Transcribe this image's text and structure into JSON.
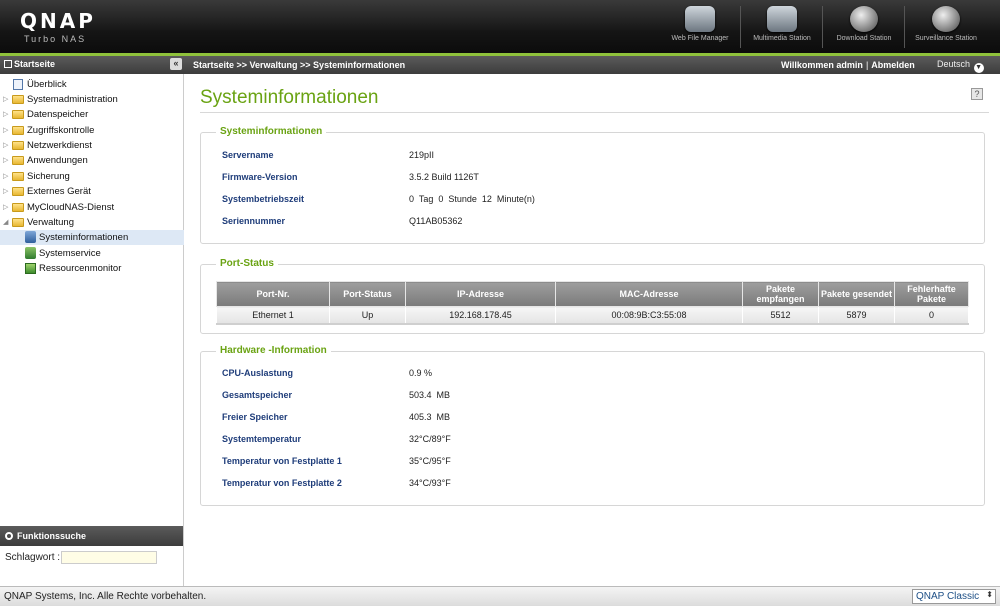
{
  "header": {
    "logo": "QNAP",
    "logo_sub": "Turbo NAS",
    "stations": [
      {
        "label": "Web File Manager",
        "icon": "web-file-manager-icon"
      },
      {
        "label": "Multimedia Station",
        "icon": "multimedia-station-icon"
      },
      {
        "label": "Download Station",
        "icon": "download-station-icon"
      },
      {
        "label": "Surveillance Station",
        "icon": "surveillance-station-icon"
      }
    ]
  },
  "navbar": {
    "home_label": "Startseite",
    "collapse_glyph": "«",
    "breadcrumb": "Startseite >> Verwaltung >> Systeminformationen",
    "welcome": "Willkommen admin",
    "separator": "|",
    "logout": "Abmelden",
    "language": "Deutsch"
  },
  "sidebar": {
    "items": [
      {
        "label": "Überblick",
        "icon": "overview-icon"
      },
      {
        "label": "Systemadministration",
        "icon": "folder-icon"
      },
      {
        "label": "Datenspeicher",
        "icon": "folder-icon"
      },
      {
        "label": "Zugriffskontrolle",
        "icon": "folder-icon"
      },
      {
        "label": "Netzwerkdienst",
        "icon": "folder-icon"
      },
      {
        "label": "Anwendungen",
        "icon": "folder-icon"
      },
      {
        "label": "Sicherung",
        "icon": "folder-icon"
      },
      {
        "label": "Externes Gerät",
        "icon": "folder-icon"
      },
      {
        "label": "MyCloudNAS-Dienst",
        "icon": "folder-icon"
      },
      {
        "label": "Verwaltung",
        "icon": "folder-open-icon"
      },
      {
        "label": "Systeminformationen",
        "icon": "system-info-icon"
      },
      {
        "label": "Systemservice",
        "icon": "system-service-icon"
      },
      {
        "label": "Ressourcenmonitor",
        "icon": "resource-monitor-icon"
      }
    ]
  },
  "search": {
    "title": "Funktionssuche",
    "label": "Schlagwort :",
    "value": ""
  },
  "main": {
    "title": "Systeminformationen",
    "help_glyph": "?",
    "system": {
      "legend": "Systeminformationen",
      "rows": [
        {
          "key": "Servername",
          "value": "219pII"
        },
        {
          "key": "Firmware-Version",
          "value": "3.5.2 Build 1126T"
        },
        {
          "key": "Systembetriebszeit",
          "value": "0  Tag  0  Stunde  12  Minute(n)"
        },
        {
          "key": "Seriennummer",
          "value": "Q11AB05362"
        }
      ]
    },
    "ports": {
      "legend": "Port-Status",
      "columns": [
        "Port-Nr.",
        "Port-Status",
        "IP-Adresse",
        "MAC-Adresse",
        "Pakete empfangen",
        "Pakete gesendet",
        "Fehlerhafte Pakete"
      ],
      "rows": [
        [
          "Ethernet 1",
          "Up",
          "192.168.178.45",
          "00:08:9B:C3:55:08",
          "5512",
          "5879",
          "0"
        ]
      ]
    },
    "hardware": {
      "legend": "Hardware -Information",
      "rows": [
        {
          "key": "CPU-Auslastung",
          "value": "0.9 %"
        },
        {
          "key": "Gesamtspeicher",
          "value": "503.4  MB"
        },
        {
          "key": "Freier Speicher",
          "value": "405.3  MB"
        },
        {
          "key": "Systemtemperatur",
          "value": "32°C/89°F"
        },
        {
          "key": "Temperatur von Festplatte 1",
          "value": "35°C/95°F"
        },
        {
          "key": "Temperatur von Festplatte 2",
          "value": "34°C/93°F"
        }
      ]
    }
  },
  "footer": {
    "copyright": "QNAP Systems, Inc. Alle Rechte vorbehalten.",
    "theme": "QNAP Classic"
  },
  "colors": {
    "accent_green": "#6aa313",
    "label_blue": "#1f3d7a",
    "topbar_dark": "#151515"
  }
}
